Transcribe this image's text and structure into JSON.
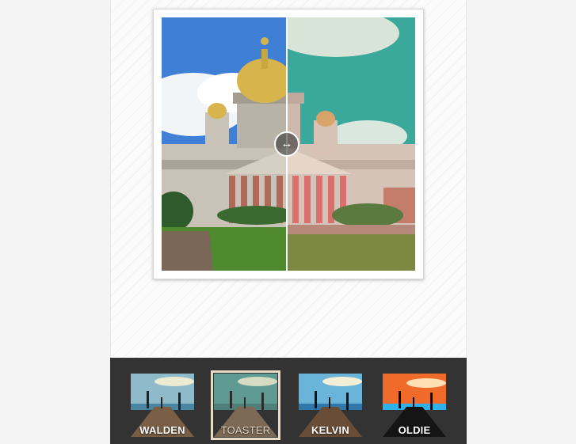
{
  "editor": {
    "compare_icon": "double-arrow-horizontal-icon",
    "compare_glyph": "↔"
  },
  "filters": {
    "selected": "TOASTER",
    "items": [
      {
        "label": "WALDEN"
      },
      {
        "label": "TOASTER"
      },
      {
        "label": "KELVIN"
      },
      {
        "label": "OLDIE"
      }
    ]
  },
  "colors": {
    "filter_bar_bg": "#333333",
    "selected_outline": "#e9dcc5"
  }
}
